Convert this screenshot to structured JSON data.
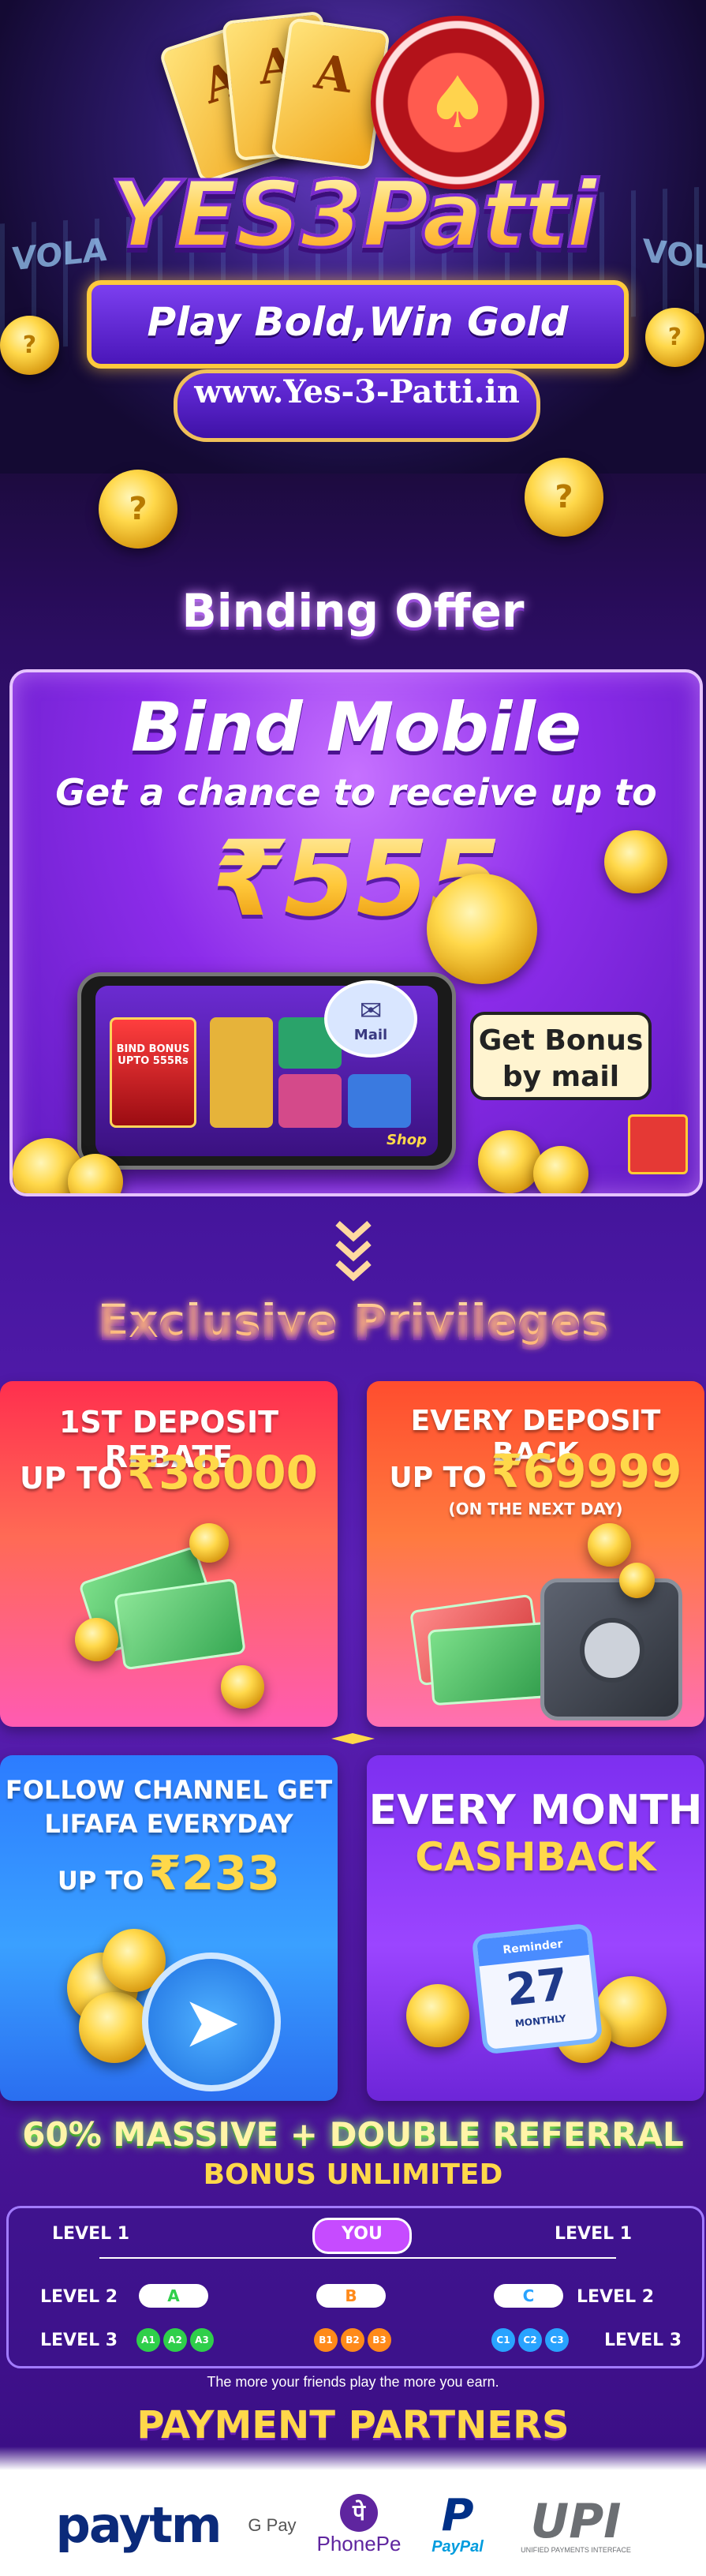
{
  "hero": {
    "logo": "YES3Patti",
    "tagline": "Play Bold,Win Gold",
    "url": "www.Yes-3-Patti.in",
    "card_letter": "A",
    "side_text_left": "VOLA",
    "side_text_right": "VOL"
  },
  "binding": {
    "section_title": "Binding Offer",
    "title": "Bind Mobile",
    "subtitle": "Get a chance to receive up to",
    "amount": "₹555",
    "callout": "Get Bonus by mail",
    "mail_label": "Mail",
    "phone_bonus": "BIND BONUS UPTO 555Rs",
    "phone_shop": "Shop"
  },
  "privileges": {
    "section_title": "Exclusive Privileges",
    "cards": [
      {
        "line1": "1ST DEPOSIT REBATE",
        "prefix": "UP TO",
        "amount": "₹38000",
        "note": ""
      },
      {
        "line1": "EVERY DEPOSIT BACK",
        "prefix": "UP TO",
        "amount": "₹69999",
        "note": "(ON THE NEXT DAY)"
      },
      {
        "line1": "FOLLOW CHANNEL GET",
        "line2": "LIFAFA EVERYDAY",
        "prefix": "UP TO",
        "amount": "₹233"
      },
      {
        "line1": "EVERY MONTH",
        "line2": "CASHBACK",
        "calendar_label": "Reminder",
        "calendar_num": "27",
        "calendar_month": "MONTHLY"
      }
    ]
  },
  "referral": {
    "title": "60% MASSIVE + DOUBLE REFERRAL",
    "subtitle": "BONUS UNLIMITED",
    "you": "YOU",
    "level1": "LEVEL 1",
    "level2": "LEVEL 2",
    "level3": "LEVEL 3",
    "nodes": [
      "A",
      "B",
      "C"
    ],
    "subs": [
      "A1",
      "A2",
      "A3",
      "B1",
      "B2",
      "B3",
      "C1",
      "C2",
      "C3"
    ],
    "node_colors": [
      "#2fcf4a",
      "#ff8a1a",
      "#29a3ff"
    ],
    "fine_print": "The more your friends play the more you earn."
  },
  "payment": {
    "title": "PAYMENT PARTNERS",
    "partners": [
      "paytm",
      "G Pay",
      "PhonePe",
      "PayPal",
      "UPI"
    ],
    "upi_sub": "UNIFIED PAYMENTS INTERFACE"
  }
}
